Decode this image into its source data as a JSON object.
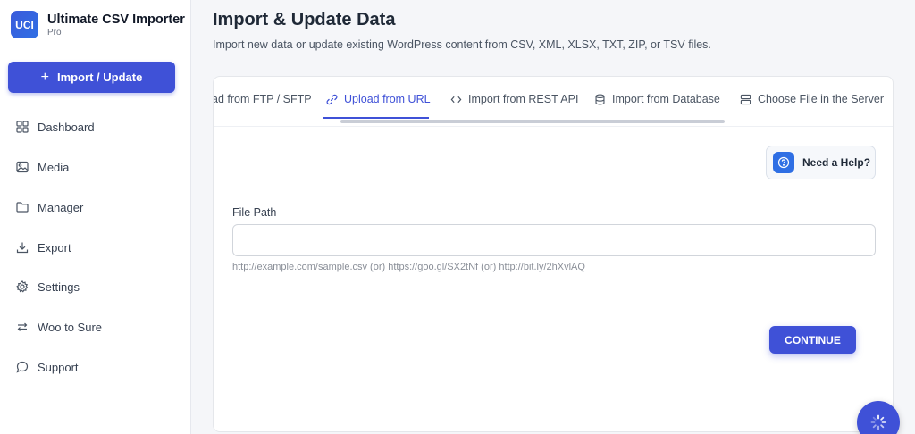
{
  "brand": {
    "logo_text": "UCI",
    "name": "Ultimate CSV Importer",
    "edition": "Pro",
    "color": "#3b5bdb"
  },
  "sidebar": {
    "import_button": "Import / Update",
    "items": [
      {
        "label": "Dashboard",
        "icon": "grid-icon"
      },
      {
        "label": "Media",
        "icon": "image-icon"
      },
      {
        "label": "Manager",
        "icon": "folder-icon"
      },
      {
        "label": "Export",
        "icon": "download-icon"
      },
      {
        "label": "Settings",
        "icon": "gear-icon"
      },
      {
        "label": "Woo to Sure",
        "icon": "swap-icon"
      },
      {
        "label": "Support",
        "icon": "chat-icon"
      }
    ]
  },
  "main": {
    "title": "Import & Update Data",
    "description": "Import new data or update existing WordPress content from CSV, XML, XLSX, TXT, ZIP, or TSV files.",
    "tabs": [
      {
        "label": "ad from FTP / SFTP",
        "icon": ""
      },
      {
        "label": "Upload from URL",
        "icon": "link-icon",
        "active": true
      },
      {
        "label": "Import from REST API",
        "icon": "code-icon"
      },
      {
        "label": "Import from Database",
        "icon": "database-icon"
      },
      {
        "label": "Choose File in the Server",
        "icon": "server-icon"
      }
    ],
    "help_button": "Need a Help?",
    "file_path": {
      "label": "File Path",
      "value": "",
      "hint": "http://example.com/sample.csv (or) https://goo.gl/SX2tNf (or) http://bit.ly/2hXvlAQ"
    },
    "continue_button": "CONTINUE"
  },
  "colors": {
    "accent": "#3f51d7",
    "help_icon": "#2f6fe4"
  }
}
